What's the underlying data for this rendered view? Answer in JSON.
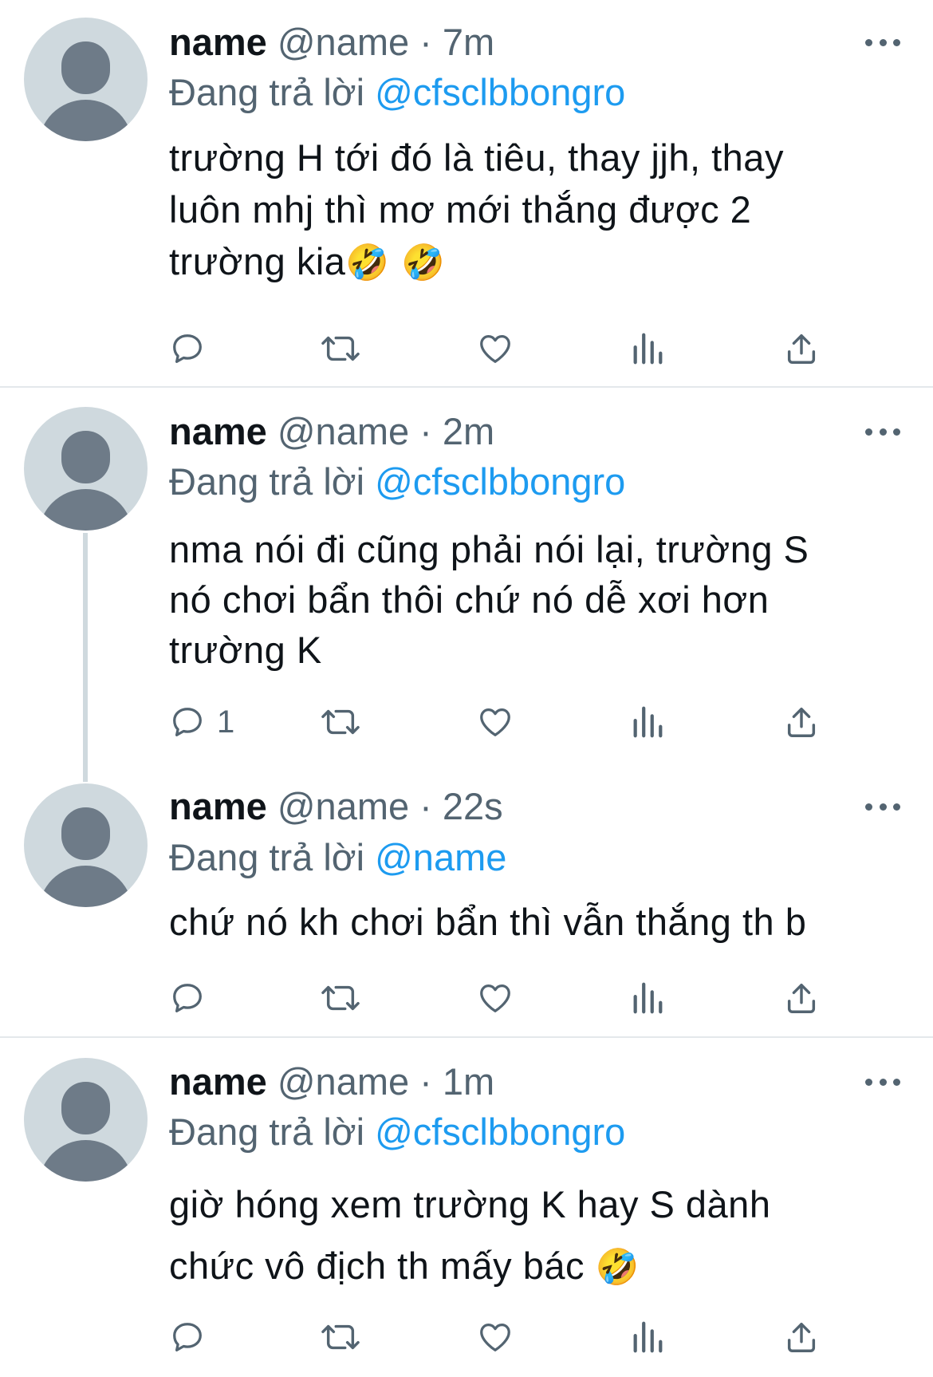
{
  "tweets": [
    {
      "name": "name",
      "meta": "@name · 7m",
      "reply_prefix": "Đang trả lời ",
      "reply_handle": "@cfsclbbongro",
      "text": "trường H tới đó là tiêu, thay jjh, thay\nluôn mhj thì mơ mới thắng được 2\ntrường kia",
      "emoji": "🤣 🤣",
      "reply_count": ""
    },
    {
      "name": "name",
      "meta": "@name · 2m",
      "reply_prefix": "Đang trả lời ",
      "reply_handle": "@cfsclbbongro",
      "text": "nma nói đi cũng phải nói lại, trường S\nnó chơi bẩn thôi chứ nó dễ xơi hơn\ntrường K",
      "reply_count": "1"
    },
    {
      "name": "name",
      "meta": "@name · 22s",
      "reply_prefix": "Đang trả lời ",
      "reply_handle": "@name",
      "text": "chứ nó kh chơi bẩn thì vẫn thắng th b",
      "reply_count": ""
    },
    {
      "name": "name",
      "meta": "@name · 1m",
      "reply_prefix": "Đang trả lời ",
      "reply_handle": "@cfsclbbongro",
      "text": "giờ hóng xem trường K hay S dành\nchức vô địch th mấy bác ",
      "emoji": "🤣",
      "reply_count": ""
    }
  ],
  "icons": {
    "reply": "reply-icon",
    "retweet": "retweet-icon",
    "like": "like-icon",
    "views": "views-icon",
    "share": "share-icon",
    "more": "more-icon"
  },
  "colors": {
    "link": "#1d9bf0",
    "secondary": "#536471",
    "avatar_bg": "#cfd9de",
    "avatar_fg": "#6e7b88"
  }
}
